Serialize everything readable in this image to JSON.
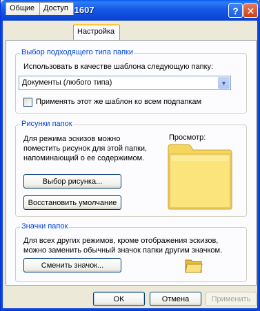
{
  "window": {
    "title": "Свойства: 102_1607",
    "help_glyph": "?",
    "close_glyph": "✕"
  },
  "tabs": [
    {
      "label": "Общие"
    },
    {
      "label": "Доступ"
    },
    {
      "label": "Настройка"
    }
  ],
  "folder_type_group": {
    "title": "Выбор подходящего типа папки",
    "template_label": "Использовать в качестве шаблона следующую папку:",
    "template_value": "Документы (любого типа)",
    "apply_subfolders_label": "Применять этот же шаблон ко всем подпапкам"
  },
  "folder_pictures_group": {
    "title": "Рисунки папок",
    "description": "Для режима эскизов можно поместить рисунок для этой папки, напоминающий о ее содержимом.",
    "choose_picture_button": "Выбор рисунка...",
    "restore_default_button": "Восстановить умолчание",
    "preview_label": "Просмотр:"
  },
  "folder_icons_group": {
    "title": "Значки папок",
    "description": "Для всех других режимов, кроме отображения эскизов, можно заменить обычный значок папки другим значком.",
    "change_icon_button": "Сменить значок..."
  },
  "footer": {
    "ok_button": "OK",
    "cancel_button": "Отмена",
    "apply_button": "Применить"
  },
  "colors": {
    "titlebar": "#0c47d8",
    "group_title": "#0046d5",
    "folder_yellow": "#fce47c"
  }
}
